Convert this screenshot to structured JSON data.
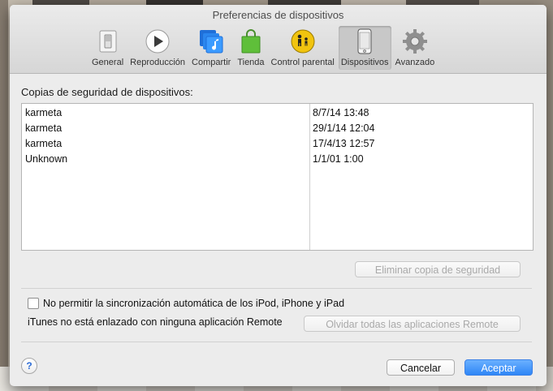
{
  "window": {
    "title": "Preferencias de dispositivos"
  },
  "toolbar": {
    "items": [
      {
        "label": "General",
        "icon": "switch-icon"
      },
      {
        "label": "Reproducción",
        "icon": "play-icon"
      },
      {
        "label": "Compartir",
        "icon": "music-share-icon"
      },
      {
        "label": "Tienda",
        "icon": "shopping-bag-icon"
      },
      {
        "label": "Control parental",
        "icon": "parental-icon"
      },
      {
        "label": "Dispositivos",
        "icon": "phone-icon",
        "selected": true
      },
      {
        "label": "Avanzado",
        "icon": "gear-icon"
      }
    ]
  },
  "backups": {
    "label": "Copias de seguridad de dispositivos:",
    "rows": [
      {
        "name": "karmeta",
        "date": "8/7/14 13:48"
      },
      {
        "name": "karmeta",
        "date": "29/1/14 12:04"
      },
      {
        "name": "karmeta",
        "date": "17/4/13 12:57"
      },
      {
        "name": "Unknown",
        "date": "1/1/01 1:00"
      }
    ],
    "delete_button": "Eliminar copia de seguridad"
  },
  "sync": {
    "checkbox_label": "No permitir la sincronización automática de los iPod, iPhone y iPad",
    "checked": false
  },
  "remote": {
    "text": "iTunes no está enlazado con ninguna aplicación Remote",
    "forget_button": "Olvidar todas las aplicaciones Remote"
  },
  "footer": {
    "help_label": "?",
    "cancel_button": "Cancelar",
    "accept_button": "Aceptar"
  },
  "colors": {
    "accent": "#2f86f6",
    "selected_tab": "#c8c8c8"
  }
}
